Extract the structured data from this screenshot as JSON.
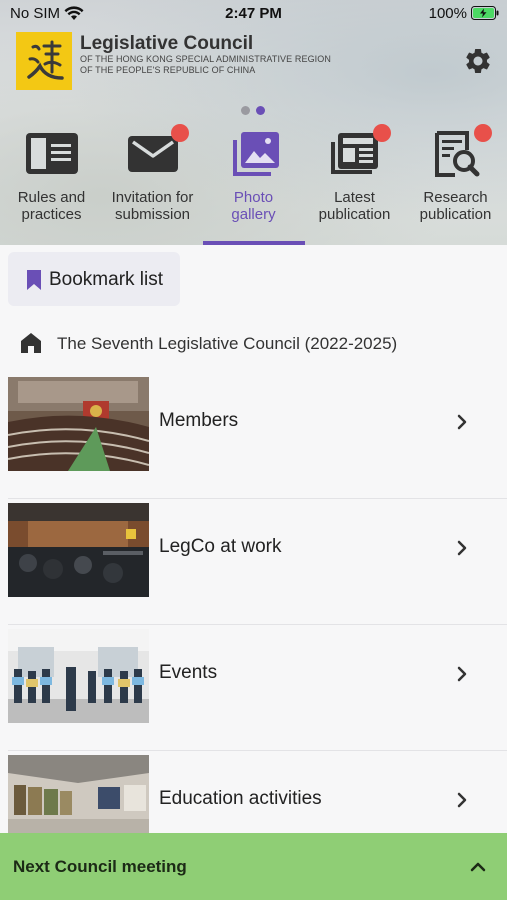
{
  "status": {
    "carrier": "No SIM",
    "time": "2:47 PM",
    "battery": "100%"
  },
  "brand": {
    "title": "Legislative Council",
    "subtitle_line1": "OF THE HONG KONG SPECIAL ADMINISTRATIVE REGION",
    "subtitle_line2": "OF THE PEOPLE'S REPUBLIC OF CHINA"
  },
  "tabs": [
    {
      "line1": "Rules and",
      "line2": "practices",
      "icon": "rules-book-icon",
      "badge": false
    },
    {
      "line1": "Invitation for",
      "line2": "submission",
      "icon": "envelope-icon",
      "badge": true
    },
    {
      "line1": "Photo",
      "line2": "gallery",
      "icon": "photo-gallery-icon",
      "badge": false,
      "active": true
    },
    {
      "line1": "Latest",
      "line2": "publication",
      "icon": "newspaper-icon",
      "badge": true
    },
    {
      "line1": "Research",
      "line2": "publication",
      "icon": "research-search-icon",
      "badge": true
    }
  ],
  "bookmark": {
    "label": "Bookmark list"
  },
  "breadcrumb": {
    "text": "The Seventh Legislative Council (2022-2025)"
  },
  "gallery": [
    {
      "label": "Members"
    },
    {
      "label": "LegCo at work"
    },
    {
      "label": "Events"
    },
    {
      "label": "Education activities"
    }
  ],
  "bottom_bar": {
    "label": "Next Council meeting"
  },
  "colors": {
    "accent": "#6a4fb6",
    "badge": "#e8504a",
    "bottom_bar": "#8fce75",
    "logo": "#f3c814"
  }
}
